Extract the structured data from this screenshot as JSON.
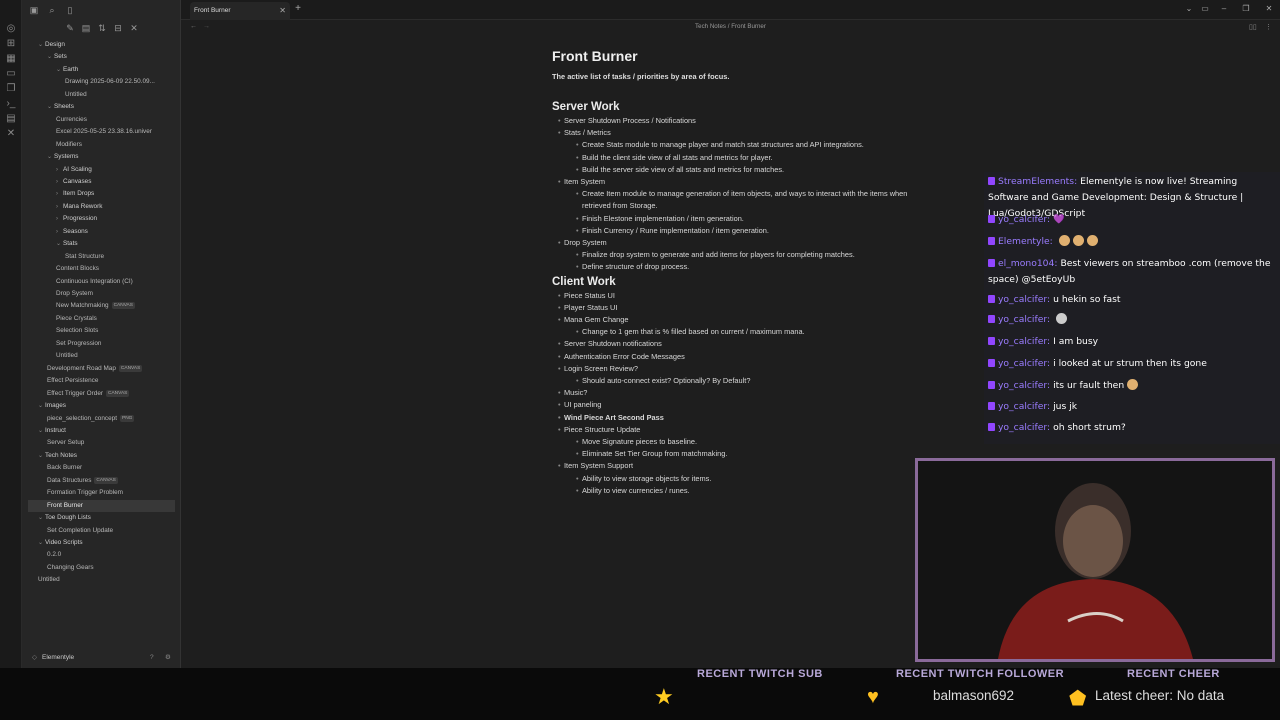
{
  "tab": {
    "title": "Front Burner"
  },
  "breadcrumb": {
    "folder": "Tech Notes",
    "sep": "/",
    "current": "Front Burner"
  },
  "vault": {
    "name": "Elementyle"
  },
  "tree": [
    {
      "label": "Design",
      "level": 0,
      "folder": true,
      "open": true
    },
    {
      "label": "Sets",
      "level": 1,
      "folder": true,
      "open": true
    },
    {
      "label": "Earth",
      "level": 2,
      "folder": true,
      "open": true
    },
    {
      "label": "Drawing 2025-06-09 22.50.09...",
      "level": 3
    },
    {
      "label": "Untitled",
      "level": 3
    },
    {
      "label": "Sheets",
      "level": 1,
      "folder": true,
      "open": true
    },
    {
      "label": "Currencies",
      "level": 2
    },
    {
      "label": "Excel 2025-05-25 23.38.16.univer",
      "level": 2
    },
    {
      "label": "Modifiers",
      "level": 2
    },
    {
      "label": "Systems",
      "level": 1,
      "folder": true,
      "open": true
    },
    {
      "label": "AI Scaling",
      "level": 2,
      "folder": true
    },
    {
      "label": "Canvases",
      "level": 2,
      "folder": true
    },
    {
      "label": "Item Drops",
      "level": 2,
      "folder": true
    },
    {
      "label": "Mana Rework",
      "level": 2,
      "folder": true
    },
    {
      "label": "Progression",
      "level": 2,
      "folder": true
    },
    {
      "label": "Seasons",
      "level": 2,
      "folder": true
    },
    {
      "label": "Stats",
      "level": 2,
      "folder": true,
      "open": true
    },
    {
      "label": "Stat Structure",
      "level": 3
    },
    {
      "label": "Content Blocks",
      "level": 2
    },
    {
      "label": "Continuous Integration (CI)",
      "level": 2
    },
    {
      "label": "Drop System",
      "level": 2
    },
    {
      "label": "New Matchmaking",
      "level": 2,
      "badge": "CANVAS"
    },
    {
      "label": "Piece Crystals",
      "level": 2
    },
    {
      "label": "Selection Slots",
      "level": 2
    },
    {
      "label": "Set Progression",
      "level": 2
    },
    {
      "label": "Untitled",
      "level": 2
    },
    {
      "label": "Development Road Map",
      "level": 1,
      "badge": "CANVAS"
    },
    {
      "label": "Effect Persistence",
      "level": 1
    },
    {
      "label": "Effect Trigger Order",
      "level": 1,
      "badge": "CANVAS"
    },
    {
      "label": "Images",
      "level": 0,
      "folder": true,
      "open": true
    },
    {
      "label": "piece_selection_concept",
      "level": 1,
      "badge": "PNG"
    },
    {
      "label": "Instruct",
      "level": 0,
      "folder": true,
      "open": true
    },
    {
      "label": "Server Setup",
      "level": 1
    },
    {
      "label": "Tech Notes",
      "level": 0,
      "folder": true,
      "open": true
    },
    {
      "label": "Back Burner",
      "level": 1
    },
    {
      "label": "Data Structures",
      "level": 1,
      "badge": "CANVAS"
    },
    {
      "label": "Formation Trigger Problem",
      "level": 1
    },
    {
      "label": "Front Burner",
      "level": 1,
      "active": true
    },
    {
      "label": "Toe Dough Lists",
      "level": 0,
      "folder": true,
      "open": true
    },
    {
      "label": "Set Completion Update",
      "level": 1
    },
    {
      "label": "Video Scripts",
      "level": 0,
      "folder": true,
      "open": true
    },
    {
      "label": "0.2.0",
      "level": 1
    },
    {
      "label": "Changing Gears",
      "level": 1
    },
    {
      "label": "Untitled",
      "level": 0
    }
  ],
  "note": {
    "title": "Front Burner",
    "description": "The active list of tasks / priorities by area of focus.",
    "sections": [
      {
        "heading": "Server Work",
        "items": [
          {
            "text": "Server Shutdown Process / Notifications",
            "level": 1
          },
          {
            "text": "Stats / Metrics",
            "level": 1
          },
          {
            "text": "Create Stats module to manage player and match stat structures and API integrations.",
            "level": 2
          },
          {
            "text": "Build the client side view of all stats and metrics for player.",
            "level": 2
          },
          {
            "text": "Build the server side view of all stats and metrics for matches.",
            "level": 2
          },
          {
            "text": "Item System",
            "level": 1
          },
          {
            "text": "Create Item module to manage generation of item objects, and ways to interact with the items when retrieved from Storage.",
            "level": 2
          },
          {
            "text": "Finish Elestone implementation / item generation.",
            "level": 2
          },
          {
            "text": "Finish Currency / Rune implementation / item generation.",
            "level": 2
          },
          {
            "text": "Drop System",
            "level": 1
          },
          {
            "text": "Finalize drop system to generate and add items for players for completing matches.",
            "level": 2
          },
          {
            "text": "Define structure of drop process.",
            "level": 2
          }
        ]
      },
      {
        "heading": "Client Work",
        "items": [
          {
            "text": "Piece Status UI",
            "level": 1
          },
          {
            "text": "Player Status UI",
            "level": 1
          },
          {
            "text": "Mana Gem Change",
            "level": 1
          },
          {
            "text": "Change to 1 gem that is % filled based on current / maximum mana.",
            "level": 2
          },
          {
            "text": "Server Shutdown notifications",
            "level": 1
          },
          {
            "text": "Authentication Error Code Messages",
            "level": 1
          },
          {
            "text": "Login Screen Review?",
            "level": 1
          },
          {
            "text": "Should auto-connect exist? Optionally? By Default?",
            "level": 2
          },
          {
            "text": "Music?",
            "level": 1
          },
          {
            "text": "UI paneling",
            "level": 1
          },
          {
            "text": "Wind Piece Art Second Pass",
            "level": 1,
            "bold": true
          },
          {
            "text": "Piece Structure Update",
            "level": 1
          },
          {
            "text": "Move Signature pieces to baseline.",
            "level": 2
          },
          {
            "text": "Eliminate Set Tier Group from matchmaking.",
            "level": 2
          },
          {
            "text": "Item System Support",
            "level": 1
          },
          {
            "text": "Ability to view storage objects for items.",
            "level": 2
          },
          {
            "text": "Ability to view currencies / runes.",
            "level": 2
          }
        ]
      }
    ]
  },
  "chat": [
    {
      "user": "StreamElements:",
      "text": "Elementyle is now live! Streaming Software and Game Development: Design & Structure | Lua/Godot3/GDScript"
    },
    {
      "user": "yo_calcifer:",
      "text": "💜"
    },
    {
      "user": "Elementyle:",
      "text": ""
    },
    {
      "user": "el_mono104:",
      "text": "Best viewers on streamboo .com (remove the space) @5etEoyUb"
    },
    {
      "user": "yo_calcifer:",
      "text": "u hekin so fast"
    },
    {
      "user": "yo_calcifer:",
      "text": ""
    },
    {
      "user": "yo_calcifer:",
      "text": "I am busy"
    },
    {
      "user": "yo_calcifer:",
      "text": "i looked at ur strum then its gone"
    },
    {
      "user": "yo_calcifer:",
      "text": "its ur fault then"
    },
    {
      "user": "yo_calcifer:",
      "text": "jus jk"
    },
    {
      "user": "yo_calcifer:",
      "text": "oh short strum?"
    }
  ],
  "overlay": {
    "sub_title": "RECENT TWITCH SUB",
    "follower_title": "RECENT TWITCH FOLLOWER",
    "follower_name": "balmason692",
    "cheer_title": "RECENT CHEER",
    "cheer_text": "Latest cheer: No data"
  },
  "colors": {
    "accent": "#9146ff",
    "bg": "#1e1e1e",
    "sidebar": "#262626"
  }
}
